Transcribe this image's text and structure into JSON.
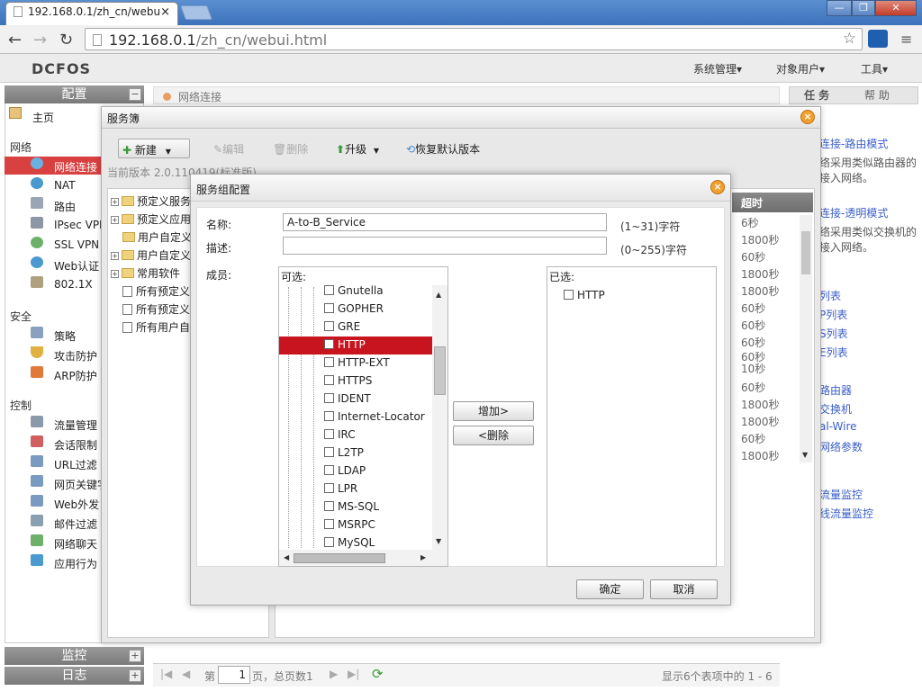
{
  "browser": {
    "tab_title": "192.168.0.1/zh_cn/webu",
    "tab_close": "×",
    "url_host": "192.168.0.1",
    "url_path": "/zh_cn/webui.html",
    "window_buttons": [
      "—",
      "❐",
      "✕"
    ]
  },
  "app": {
    "logo": "DCFOS",
    "top_menu": [
      "系统管理▾",
      "对象用户▾",
      "工具▾"
    ]
  },
  "left_nav": {
    "header": "配置",
    "home": "主页",
    "groups": [
      {
        "title": "网络",
        "items": [
          "网络连接",
          "NAT",
          "路由",
          "IPsec VPN",
          "SSL VPN",
          "Web认证",
          "802.1X"
        ]
      },
      {
        "title": "安全",
        "items": [
          "策略",
          "攻击防护",
          "ARP防护"
        ]
      },
      {
        "title": "控制",
        "items": [
          "流量管理",
          "会话限制",
          "URL过滤",
          "网页关键字",
          "Web外发",
          "邮件过滤",
          "网络聊天",
          "应用行为"
        ]
      }
    ],
    "monitor": "监控",
    "log": "日志"
  },
  "breadcrumb": "网络连接",
  "right_panel": {
    "tabs": [
      "任 务",
      "帮 助"
    ],
    "lines": [
      {
        "text": "连接-路由模式",
        "link": true
      },
      {
        "text": "络采用类似路由器的",
        "link": false
      },
      {
        "text": "接入网络。",
        "link": false
      },
      {
        "text": "连接-透明模式",
        "link": true
      },
      {
        "text": "络采用类似交换机的",
        "link": false
      },
      {
        "text": "接入网络。",
        "link": false
      },
      {
        "text": "列表",
        "link": true
      },
      {
        "text": "P列表",
        "link": true
      },
      {
        "text": "S列表",
        "link": true
      },
      {
        "text": "E列表",
        "link": true
      },
      {
        "text": "路由器",
        "link": true
      },
      {
        "text": "交换机",
        "link": true
      },
      {
        "text": "al-Wire",
        "link": true
      },
      {
        "text": "网络参数",
        "link": true
      },
      {
        "text": "流量监控",
        "link": true
      },
      {
        "text": "线流量监控",
        "link": true
      }
    ]
  },
  "pager": {
    "page_prefix": "第",
    "page_value": "1",
    "page_suffix": "页，总页数1",
    "summary": "显示6个表项中的 1 - 6"
  },
  "service_book": {
    "title": "服务簿",
    "toolbar": {
      "new": "新建",
      "edit": "编辑",
      "delete": "删除",
      "upgrade": "升级",
      "restore": "恢复默认版本"
    },
    "version": "当前版本 2.0.110419(标准版)",
    "tree": [
      {
        "label": "预定义服务",
        "type": "folder-exp"
      },
      {
        "label": "预定义应用",
        "type": "folder-exp"
      },
      {
        "label": "用户自定义",
        "type": "folder"
      },
      {
        "label": "用户自定义",
        "type": "folder-exp"
      },
      {
        "label": "常用软件",
        "type": "folder-exp"
      },
      {
        "label": "所有预定义",
        "type": "list"
      },
      {
        "label": "所有预定义",
        "type": "list"
      },
      {
        "label": "所有用户自",
        "type": "list"
      }
    ],
    "grid_header": "超时",
    "timeouts": [
      "6秒",
      "1800秒",
      "60秒",
      "1800秒",
      "1800秒",
      "60秒",
      "60秒",
      "60秒",
      "60秒",
      "10秒",
      "60秒",
      "1800秒",
      "1800秒",
      "60秒",
      "1800秒"
    ]
  },
  "group_dialog": {
    "title": "服务组配置",
    "name_label": "名称:",
    "name_value": "A-to-B_Service",
    "name_hint": "(1~31)字符",
    "desc_label": "描述:",
    "desc_value": "",
    "desc_hint": "(0~255)字符",
    "members_label": "成员:",
    "available_title": "可选:",
    "available": [
      "Gnutella",
      "GOPHER",
      "GRE",
      "HTTP",
      "HTTP-EXT",
      "HTTPS",
      "IDENT",
      "Internet-Locator",
      "IRC",
      "L2TP",
      "LDAP",
      "LPR",
      "MS-SQL",
      "MSRPC",
      "MySQL"
    ],
    "highlighted": "HTTP",
    "selected_title": "已选:",
    "selected": [
      "HTTP"
    ],
    "add_button": "增加>",
    "remove_button": "<删除",
    "ok_button": "确定",
    "cancel_button": "取消"
  }
}
